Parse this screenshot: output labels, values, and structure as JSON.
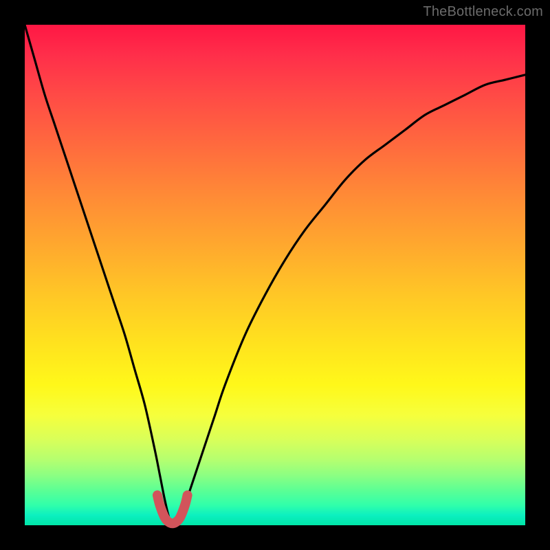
{
  "watermark": {
    "text": "TheBottleneck.com"
  },
  "colors": {
    "background": "#000000",
    "curve": "#000000",
    "highlight": "#d2545b"
  },
  "chart_data": {
    "type": "line",
    "title": "",
    "xlabel": "",
    "ylabel": "",
    "xlim": [
      0,
      100
    ],
    "ylim": [
      0,
      100
    ],
    "grid": false,
    "legend": false,
    "series": [
      {
        "name": "bottleneck-curve",
        "x": [
          0,
          2,
          4,
          6,
          8,
          10,
          12,
          14,
          16,
          18,
          20,
          22,
          24,
          26,
          27,
          28,
          29,
          30,
          31,
          32,
          34,
          36,
          38,
          40,
          44,
          48,
          52,
          56,
          60,
          64,
          68,
          72,
          76,
          80,
          84,
          88,
          92,
          96,
          100
        ],
        "values": [
          100,
          93,
          86,
          80,
          74,
          68,
          62,
          56,
          50,
          44,
          38,
          31,
          24,
          15,
          10,
          5,
          1,
          0,
          1,
          4,
          10,
          16,
          22,
          28,
          38,
          46,
          53,
          59,
          64,
          69,
          73,
          76,
          79,
          82,
          84,
          86,
          88,
          89,
          90
        ]
      },
      {
        "name": "optimal-region",
        "x": [
          26.5,
          27,
          28,
          29,
          30,
          31,
          32,
          32.5
        ],
        "values": [
          6.0,
          4.0,
          1.5,
          0.5,
          0.5,
          1.5,
          4.0,
          6.0
        ]
      }
    ],
    "annotations": []
  }
}
